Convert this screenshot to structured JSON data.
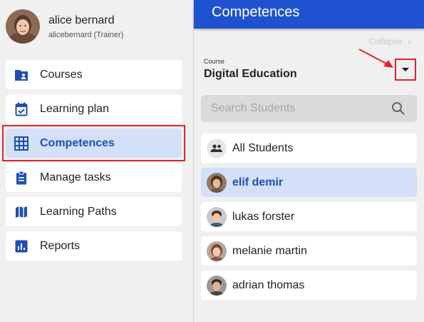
{
  "profile": {
    "name": "alice bernard",
    "role": "alicebernard (Trainer)"
  },
  "nav": {
    "items": [
      {
        "label": "Courses",
        "icon": "folder-person-icon",
        "active": false
      },
      {
        "label": "Learning plan",
        "icon": "calendar-check-icon",
        "active": false
      },
      {
        "label": "Competences",
        "icon": "grid-icon",
        "active": true
      },
      {
        "label": "Manage tasks",
        "icon": "clipboard-icon",
        "active": false
      },
      {
        "label": "Learning Paths",
        "icon": "map-icon",
        "active": false
      },
      {
        "label": "Reports",
        "icon": "bar-chart-icon",
        "active": false
      }
    ]
  },
  "panel": {
    "title": "Competences",
    "collapse_label": "Collapse",
    "course_caption": "Course",
    "course_name": "Digital Education",
    "search_placeholder": "Search Students"
  },
  "students": [
    {
      "name": "All Students",
      "icon": "group-icon",
      "active": false
    },
    {
      "name": "elif demir",
      "icon": "avatar",
      "active": true
    },
    {
      "name": "lukas forster",
      "icon": "avatar",
      "active": false
    },
    {
      "name": "melanie martin",
      "icon": "avatar",
      "active": false
    },
    {
      "name": "adrian thomas",
      "icon": "avatar",
      "active": false
    }
  ],
  "colors": {
    "accent": "#1f52d0",
    "active_bg": "#d3e0f8",
    "highlight": "#e0242a"
  }
}
